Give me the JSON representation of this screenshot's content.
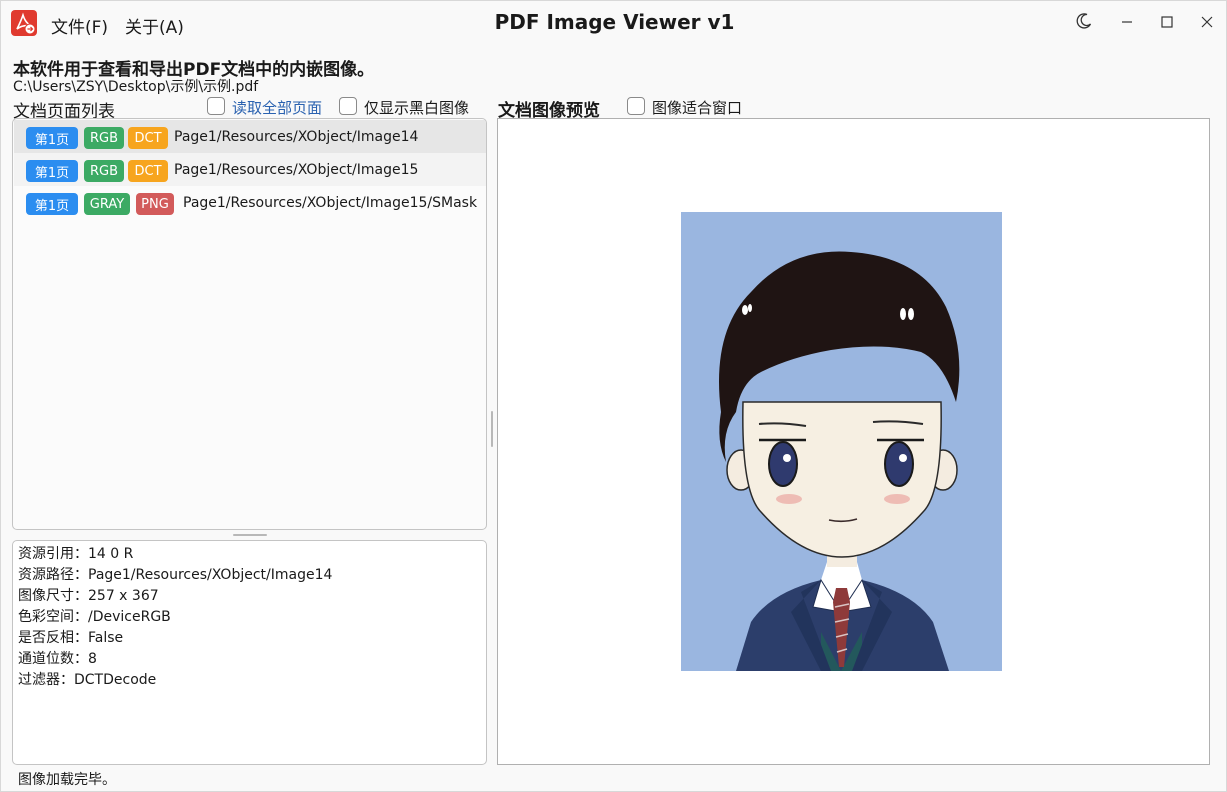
{
  "window": {
    "title": "PDF Image Viewer v1",
    "menu": {
      "file": "文件(F)",
      "about": "关于(A)"
    }
  },
  "header": {
    "description": "本软件用于查看和导出PDF文档中的内嵌图像。",
    "filepath": "C:\\Users\\ZSY\\Desktop\\示例\\示例.pdf"
  },
  "list": {
    "title": "文档页面列表",
    "read_all_label": "读取全部页面",
    "bw_only_label": "仅显示黑白图像",
    "items": [
      {
        "page": "第1页",
        "colorspace": "RGB",
        "filter": "DCT",
        "path": "Page1/Resources/XObject/Image14"
      },
      {
        "page": "第1页",
        "colorspace": "RGB",
        "filter": "DCT",
        "path": "Page1/Resources/XObject/Image15"
      },
      {
        "page": "第1页",
        "colorspace": "GRAY",
        "filter": "PNG",
        "path": "Page1/Resources/XObject/Image15/SMask"
      }
    ]
  },
  "info": [
    "资源引用：14 0 R",
    "资源路径：Page1/Resources/XObject/Image14",
    "图像尺寸：257 x 367",
    "色彩空间：/DeviceRGB",
    "是否反相：False",
    "通道位数：8",
    "过滤器：DCTDecode"
  ],
  "preview": {
    "title": "文档图像预览",
    "fit_label": "图像适合窗口",
    "image_subject": "cartoon-boy-portrait"
  },
  "status": "图像加载完毕。",
  "colors": {
    "badge_page": "#2b8df0",
    "badge_colorspace": "#3caa64",
    "badge_dct": "#f7a51e",
    "badge_png": "#d25a5a",
    "image_background": "#9ab6e0",
    "app_icon": "#e03a2f"
  }
}
